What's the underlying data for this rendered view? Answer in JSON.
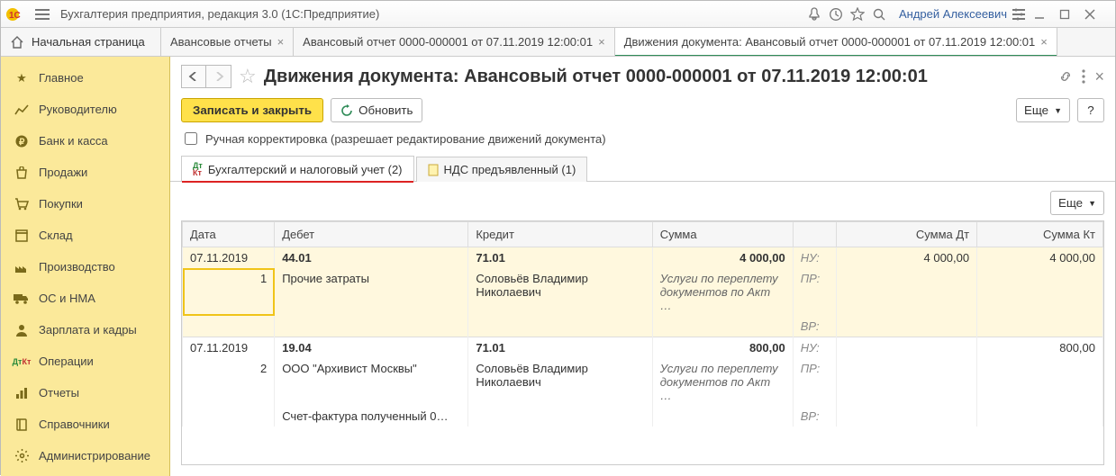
{
  "titlebar": {
    "app_title": "Бухгалтерия предприятия, редакция 3.0  (1С:Предприятие)",
    "user": "Андрей Алексеевич"
  },
  "tabs": {
    "home": "Начальная страница",
    "items": [
      {
        "label": "Авансовые отчеты"
      },
      {
        "label": "Авансовый отчет 0000-000001 от 07.11.2019 12:00:01"
      },
      {
        "label": "Движения документа: Авансовый отчет 0000-000001 от 07.11.2019 12:00:01"
      }
    ],
    "active": 2
  },
  "sidebar": [
    "Главное",
    "Руководителю",
    "Банк и касса",
    "Продажи",
    "Покупки",
    "Склад",
    "Производство",
    "ОС и НМА",
    "Зарплата и кадры",
    "Операции",
    "Отчеты",
    "Справочники",
    "Администрирование"
  ],
  "page": {
    "title": "Движения документа: Авансовый отчет 0000-000001 от 07.11.2019 12:00:01",
    "save_close": "Записать и закрыть",
    "refresh": "Обновить",
    "more": "Еще",
    "help": "?",
    "manual_edit": "Ручная корректировка (разрешает редактирование движений документа)"
  },
  "subtabs": [
    {
      "label": "Бухгалтерский и налоговый учет (2)"
    },
    {
      "label": "НДС предъявленный (1)"
    }
  ],
  "grid": {
    "headers": {
      "date": "Дата",
      "debit": "Дебет",
      "credit": "Кредит",
      "sum": "Сумма",
      "sumdt": "Сумма Дт",
      "sumkt": "Сумма Кт"
    },
    "rows": [
      {
        "date": "07.11.2019",
        "n": "1",
        "debit_acc": "44.01",
        "debit_txt": "Прочие затраты",
        "credit_acc": "71.01",
        "credit_txt": "Соловьёв Владимир Николаевич",
        "sum": "4 000,00",
        "sum_desc": "Услуги по переплету документов по Акт …",
        "nu": "НУ:",
        "pr": "ПР:",
        "vr": "ВР:",
        "sumdt": "4 000,00",
        "sumkt": "4 000,00",
        "selected": true
      },
      {
        "date": "07.11.2019",
        "n": "2",
        "debit_acc": "19.04",
        "debit_txt": "ООО \"Архивист Москвы\"",
        "debit_txt2": "Счет-фактура полученный 0…",
        "credit_acc": "71.01",
        "credit_txt": "Соловьёв Владимир Николаевич",
        "sum": "800,00",
        "sum_desc": "Услуги по переплету документов по Акт …",
        "nu": "НУ:",
        "pr": "ПР:",
        "vr": "ВР:",
        "sumdt": "",
        "sumkt": "800,00",
        "selected": false
      }
    ]
  }
}
